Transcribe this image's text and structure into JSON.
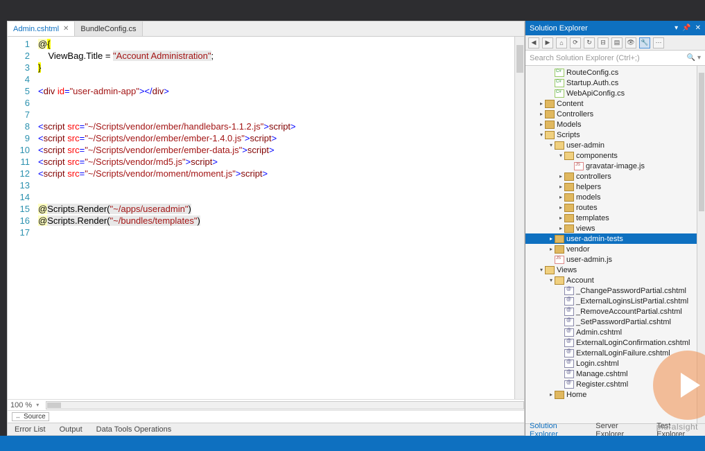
{
  "tabs": [
    {
      "label": "Admin.cshtml",
      "active": true
    },
    {
      "label": "BundleConfig.cs",
      "active": false
    }
  ],
  "gutter_lines": [
    "1",
    "2",
    "3",
    "4",
    "5",
    "6",
    "7",
    "8",
    "9",
    "10",
    "11",
    "12",
    "13",
    "14",
    "15",
    "16",
    "17"
  ],
  "code": {
    "l2_viewbag": "ViewBag.Title = ",
    "l2_str": "\"Account Administration\"",
    "l2_end": ";",
    "l5_open": "<",
    "l5_tag": "div",
    "l5_sp": " ",
    "l5_attr": "id",
    "l5_eq": "=",
    "l5_val": "\"user-admin-app\"",
    "l5_mid": "></",
    "l5_close": ">",
    "scripts": [
      "\"~/Scripts/vendor/ember/handlebars-1.1.2.js\"",
      "\"~/Scripts/vendor/ember/ember-1.4.0.js\"",
      "\"~/Scripts/vendor/ember/ember-data.js\"",
      "\"~/Scripts/vendor/md5.js\"",
      "\"~/Scripts/vendor/moment/moment.js\""
    ],
    "r15_arg": "\"~/apps/useradmin\"",
    "r16_arg": "\"~/bundles/templates\"",
    "scripts_word": "Scripts",
    "render_word": ".Render(",
    "render_close": ")",
    "script_open_a": "<",
    "script_tag": "script",
    "script_sp": " ",
    "script_src": "src",
    "script_eq": "=",
    "script_mid": "></",
    "script_close": ">",
    "at": "@",
    "lbrace": "{",
    "rbrace": "}"
  },
  "editor": {
    "zoom": "100 %",
    "source_btn": "Source"
  },
  "tool_windows": [
    "Error List",
    "Output",
    "Data Tools Operations"
  ],
  "sol_explorer": {
    "title": "Solution Explorer",
    "search_placeholder": "Search Solution Explorer (Ctrl+;)",
    "bottom_tabs": [
      "Solution Explorer",
      "Server Explorer",
      "Test Explorer"
    ]
  },
  "tree": [
    {
      "indent": 2,
      "arrow": "none",
      "icon": "cs",
      "label": "RouteConfig.cs"
    },
    {
      "indent": 2,
      "arrow": "none",
      "icon": "cs",
      "label": "Startup.Auth.cs"
    },
    {
      "indent": 2,
      "arrow": "none",
      "icon": "cs",
      "label": "WebApiConfig.cs"
    },
    {
      "indent": 1,
      "arrow": "closed",
      "icon": "folder",
      "label": "Content"
    },
    {
      "indent": 1,
      "arrow": "closed",
      "icon": "folder",
      "label": "Controllers"
    },
    {
      "indent": 1,
      "arrow": "closed",
      "icon": "folder",
      "label": "Models"
    },
    {
      "indent": 1,
      "arrow": "open",
      "icon": "folder-open",
      "label": "Scripts"
    },
    {
      "indent": 2,
      "arrow": "open",
      "icon": "folder-open",
      "label": "user-admin"
    },
    {
      "indent": 3,
      "arrow": "open",
      "icon": "folder-open",
      "label": "components"
    },
    {
      "indent": 4,
      "arrow": "none",
      "icon": "js",
      "label": "gravatar-image.js"
    },
    {
      "indent": 3,
      "arrow": "closed",
      "icon": "folder",
      "label": "controllers"
    },
    {
      "indent": 3,
      "arrow": "closed",
      "icon": "folder",
      "label": "helpers"
    },
    {
      "indent": 3,
      "arrow": "closed",
      "icon": "folder",
      "label": "models"
    },
    {
      "indent": 3,
      "arrow": "closed",
      "icon": "folder",
      "label": "routes"
    },
    {
      "indent": 3,
      "arrow": "closed",
      "icon": "folder",
      "label": "templates"
    },
    {
      "indent": 3,
      "arrow": "closed",
      "icon": "folder",
      "label": "views"
    },
    {
      "indent": 2,
      "arrow": "closed",
      "icon": "folder",
      "label": "user-admin-tests",
      "selected": true
    },
    {
      "indent": 2,
      "arrow": "closed",
      "icon": "folder",
      "label": "vendor"
    },
    {
      "indent": 2,
      "arrow": "none",
      "icon": "js",
      "label": "user-admin.js"
    },
    {
      "indent": 1,
      "arrow": "open",
      "icon": "folder-open",
      "label": "Views"
    },
    {
      "indent": 2,
      "arrow": "open",
      "icon": "folder-open",
      "label": "Account"
    },
    {
      "indent": 3,
      "arrow": "none",
      "icon": "cshtml",
      "label": "_ChangePasswordPartial.cshtml"
    },
    {
      "indent": 3,
      "arrow": "none",
      "icon": "cshtml",
      "label": "_ExternalLoginsListPartial.cshtml"
    },
    {
      "indent": 3,
      "arrow": "none",
      "icon": "cshtml",
      "label": "_RemoveAccountPartial.cshtml"
    },
    {
      "indent": 3,
      "arrow": "none",
      "icon": "cshtml",
      "label": "_SetPasswordPartial.cshtml"
    },
    {
      "indent": 3,
      "arrow": "none",
      "icon": "cshtml",
      "label": "Admin.cshtml"
    },
    {
      "indent": 3,
      "arrow": "none",
      "icon": "cshtml",
      "label": "ExternalLoginConfirmation.cshtml"
    },
    {
      "indent": 3,
      "arrow": "none",
      "icon": "cshtml",
      "label": "ExternalLoginFailure.cshtml"
    },
    {
      "indent": 3,
      "arrow": "none",
      "icon": "cshtml",
      "label": "Login.cshtml"
    },
    {
      "indent": 3,
      "arrow": "none",
      "icon": "cshtml",
      "label": "Manage.cshtml"
    },
    {
      "indent": 3,
      "arrow": "none",
      "icon": "cshtml",
      "label": "Register.cshtml"
    },
    {
      "indent": 2,
      "arrow": "closed",
      "icon": "folder",
      "label": "Home"
    }
  ],
  "status": {
    "left": "",
    "ln": "",
    "col": "",
    "ch": ""
  },
  "brand": "pluralsight"
}
